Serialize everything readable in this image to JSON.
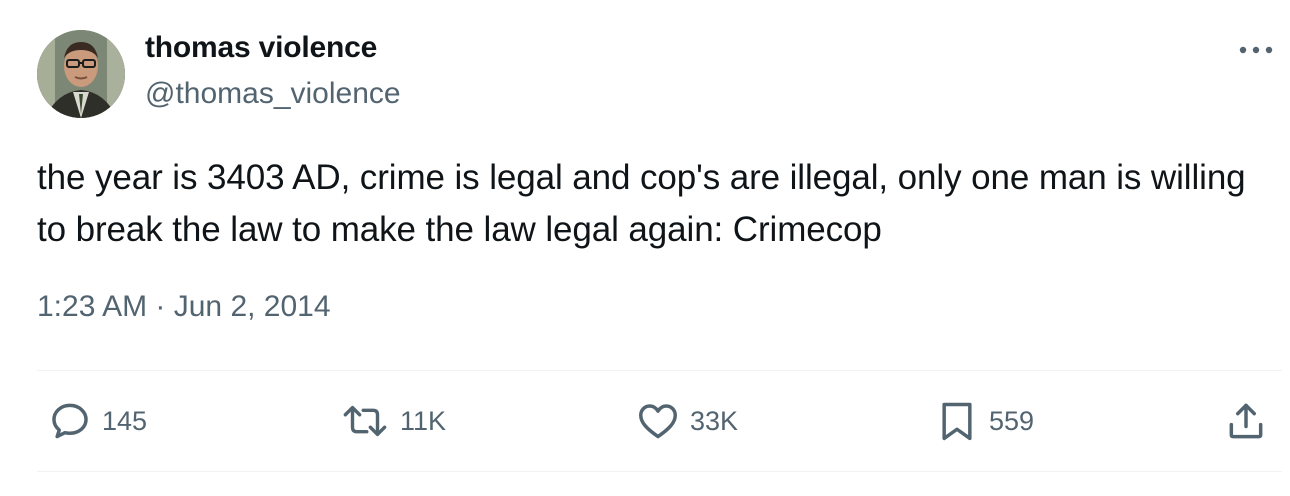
{
  "author": {
    "name": "thomas violence",
    "handle": "@thomas_violence"
  },
  "tweet": {
    "text": "the year is 3403 AD, crime is legal and cop's are illegal, only one man is willing to break the law to make the law legal again: Crimecop",
    "time": "1:23 AM",
    "separator": " · ",
    "date": "Jun 2, 2014"
  },
  "actions": {
    "replies": "145",
    "retweets": "11K",
    "likes": "33K",
    "bookmarks": "559"
  },
  "icons": {
    "more": "more-horizontal-icon",
    "reply": "reply-bubble-icon",
    "retweet": "retweet-arrows-icon",
    "like": "heart-icon",
    "bookmark": "bookmark-icon",
    "share": "share-upload-icon"
  },
  "colors": {
    "text_primary": "#0f1419",
    "text_secondary": "#536471",
    "divider": "#eff3f4"
  }
}
